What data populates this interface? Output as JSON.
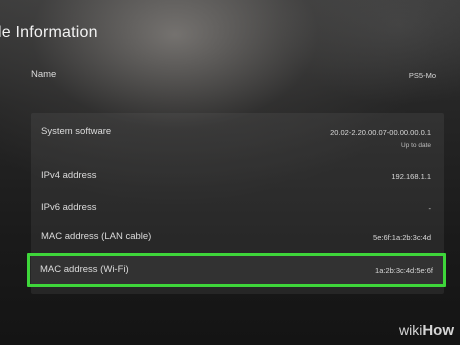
{
  "page_title": "le Information",
  "name_row": {
    "label": "Name",
    "value": "PS5-Mo"
  },
  "rows": [
    {
      "label": "System software",
      "value": "20.02-2.20.00.07-00.00.00.0.1",
      "sub": "Up to date"
    },
    {
      "label": "IPv4 address",
      "value": "192.168.1.1"
    },
    {
      "label": "IPv6 address",
      "value": "-"
    },
    {
      "label": "MAC address (LAN cable)",
      "value": "5e:6f:1a:2b:3c:4d"
    }
  ],
  "highlighted_row": {
    "label": "MAC address (Wi-Fi)",
    "value": "1a:2b:3c:4d:5e:6f"
  },
  "watermark": {
    "part1": "wiki",
    "part2": "How"
  },
  "colors": {
    "highlight": "#3ed63a",
    "background": "#1a1a1a"
  }
}
